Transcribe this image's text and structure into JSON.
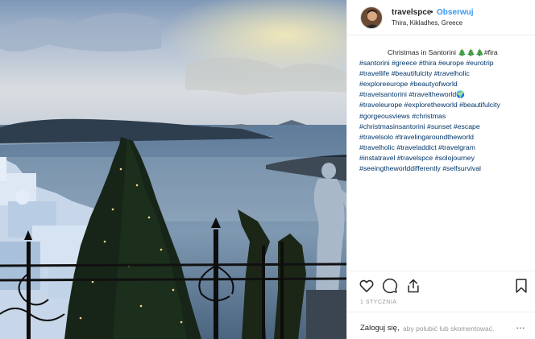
{
  "header": {
    "username": "travelspce",
    "separator": "•",
    "follow_label": "Obserwuj",
    "location": "Thira, Kikladhes, Greece"
  },
  "caption": {
    "title": "Christmas in Santorini 🎄🎄🎄#fira",
    "lines": [
      "#santorini #greece #thira #europe #eurotrip",
      "#travellife #beautifulcity #travelholic",
      "#exploreeurope #beautyofworld",
      "#travelsantorini #traveltheworld🌍",
      "#traveleurope #exploretheworld #beautifulcity",
      "#gorgeousviews #christmas",
      "#christmasinsantorini #sunset #escape",
      "#travelsolo #travelingaroundtheworld",
      "#travelholic #traveladdict #travelgram",
      "#instatravel #travelspce #solojourney",
      "#seeingtheworlddifferently #selfsurvival"
    ]
  },
  "actions": {
    "like_icon": "heart-icon",
    "comment_icon": "comment-icon",
    "share_icon": "share-icon",
    "save_icon": "bookmark-icon"
  },
  "date": "1 STYCZNIA",
  "footer": {
    "login_label": "Zaloguj się,",
    "rest_text": "aby polubić lub skomentować.",
    "more_label": "…"
  },
  "colors": {
    "link": "#3897f0",
    "hashtag": "#003569",
    "muted": "#999999",
    "border": "#efefef"
  }
}
